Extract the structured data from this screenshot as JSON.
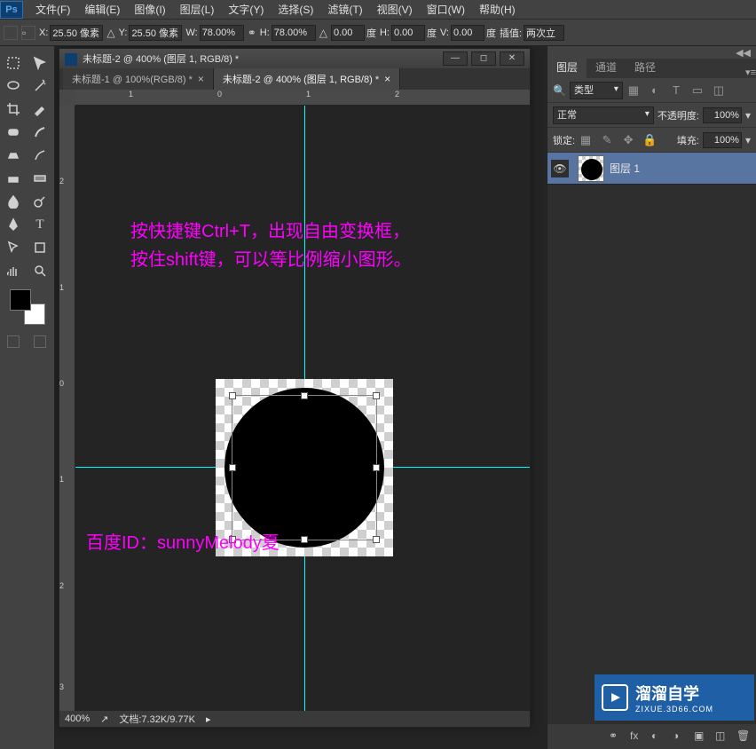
{
  "menubar": {
    "items": [
      "文件(F)",
      "编辑(E)",
      "图像(I)",
      "图层(L)",
      "文字(Y)",
      "选择(S)",
      "滤镜(T)",
      "视图(V)",
      "窗口(W)",
      "帮助(H)"
    ]
  },
  "options": {
    "x_label": "X:",
    "x_value": "25.50 像素",
    "y_label": "Y:",
    "y_value": "25.50 像素",
    "w_label": "W:",
    "w_value": "78.00%",
    "h_label": "H:",
    "h_value": "78.00%",
    "angle_value": "0.00",
    "angle_unit": "度",
    "skewh_label": "H:",
    "skewh_value": "0.00",
    "skewh_unit": "度",
    "skewv_label": "V:",
    "skewv_value": "0.00",
    "skewv_unit": "度",
    "interp_label": "插值:",
    "interp_value": "两次立"
  },
  "doc": {
    "title": "未标题-2 @ 400% (图层 1, RGB/8) *",
    "tabs": [
      {
        "label": "未标题-1 @ 100%(RGB/8) *",
        "active": false
      },
      {
        "label": "未标题-2 @ 400% (图层 1, RGB/8) *",
        "active": true
      }
    ],
    "zoom": "400%",
    "docinfo": "文档:7.32K/9.77K",
    "ruler": {
      "hticks": [
        "1",
        "0",
        "1",
        "2"
      ],
      "vticks": [
        "2",
        "1",
        "0",
        "1",
        "2",
        "3"
      ]
    }
  },
  "annotation": {
    "line1": "按快捷键Ctrl+T，出现自由变换框，\n按住shift键，可以等比例缩小图形。",
    "line2": "百度ID：sunnyMelody夏"
  },
  "panels": {
    "tabs": [
      "图层",
      "通道",
      "路径"
    ],
    "filter_label": "类型",
    "blend_mode": "正常",
    "opacity_label": "不透明度:",
    "opacity_value": "100%",
    "lock_label": "锁定:",
    "fill_label": "填充:",
    "fill_value": "100%",
    "layer_name": "图层 1"
  },
  "watermark": {
    "name": "溜溜自学",
    "url": "ZIXUE.3D66.COM"
  }
}
